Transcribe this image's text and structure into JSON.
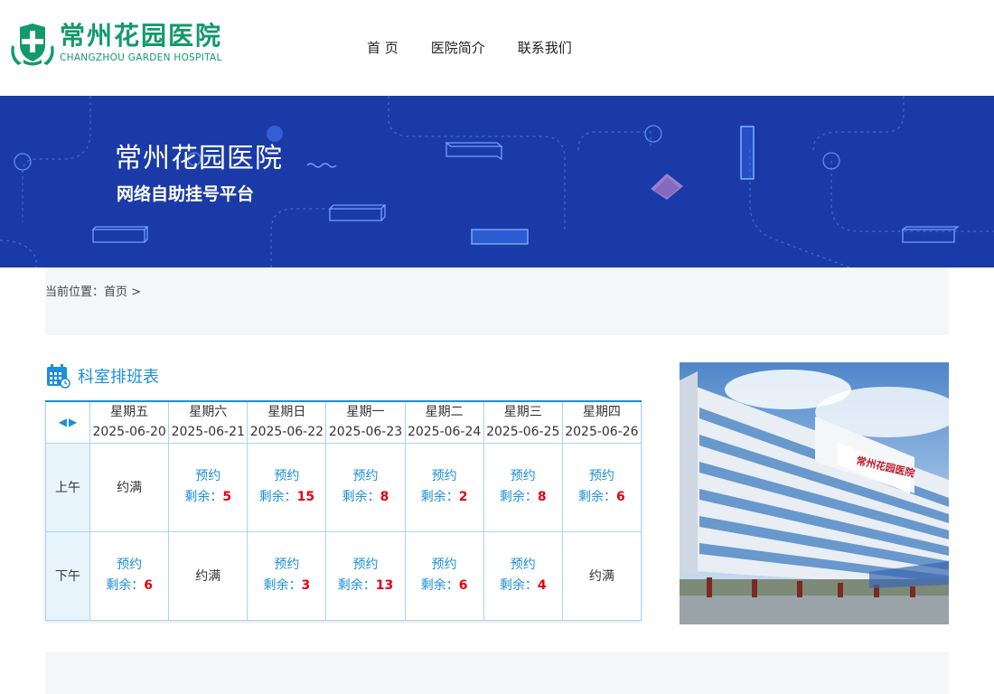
{
  "header": {
    "logo_cn": "常州花园医院",
    "logo_en": "CHANGZHOU GARDEN HOSPITAL",
    "nav": [
      "首 页",
      "医院简介",
      "联系我们"
    ]
  },
  "banner": {
    "title": "常州花园医院",
    "subtitle": "网络自助挂号平台"
  },
  "breadcrumb": {
    "prefix": "当前位置：",
    "home": "首页",
    "sep": " >"
  },
  "schedule": {
    "title": "科室排班表",
    "prev_arrow": "◀",
    "next_arrow": "▶",
    "days": [
      {
        "weekday": "星期五",
        "date": "2025-06-20"
      },
      {
        "weekday": "星期六",
        "date": "2025-06-21"
      },
      {
        "weekday": "星期日",
        "date": "2025-06-22"
      },
      {
        "weekday": "星期一",
        "date": "2025-06-23"
      },
      {
        "weekday": "星期二",
        "date": "2025-06-24"
      },
      {
        "weekday": "星期三",
        "date": "2025-06-25"
      },
      {
        "weekday": "星期四",
        "date": "2025-06-26"
      }
    ],
    "book_label": "预约",
    "remain_label": "剩余：",
    "full_label": "约满",
    "rows": [
      {
        "period": "上午",
        "cells": [
          {
            "status": "full"
          },
          {
            "status": "open",
            "remaining": "5"
          },
          {
            "status": "open",
            "remaining": "15"
          },
          {
            "status": "open",
            "remaining": "8"
          },
          {
            "status": "open",
            "remaining": "2"
          },
          {
            "status": "open",
            "remaining": "8"
          },
          {
            "status": "open",
            "remaining": "6"
          }
        ]
      },
      {
        "period": "下午",
        "cells": [
          {
            "status": "open",
            "remaining": "6"
          },
          {
            "status": "full"
          },
          {
            "status": "open",
            "remaining": "3"
          },
          {
            "status": "open",
            "remaining": "13"
          },
          {
            "status": "open",
            "remaining": "6"
          },
          {
            "status": "open",
            "remaining": "4"
          },
          {
            "status": "full"
          }
        ]
      }
    ]
  },
  "photo": {
    "sign_text": "常州花园医院"
  },
  "colors": {
    "brand_green": "#129a6a",
    "banner_blue": "#1a3aa8",
    "accent_blue": "#1c8fd6",
    "number_red": "#e60012"
  }
}
